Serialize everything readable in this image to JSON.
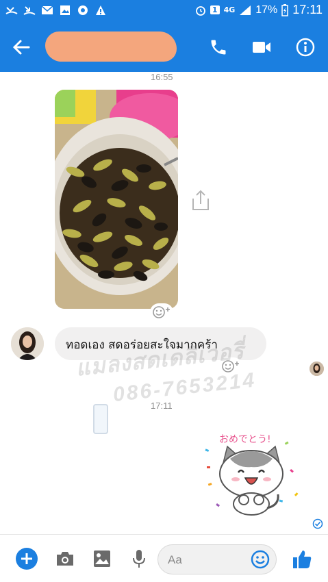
{
  "status_bar": {
    "battery_percent": "17%",
    "time": "17:11",
    "network": "4G",
    "sim_slot": "1"
  },
  "header": {
    "back_icon": "arrow-left-icon",
    "call_icon": "phone-icon",
    "video_icon": "video-camera-icon",
    "info_icon": "info-icon"
  },
  "chat": {
    "timestamp_1": "16:55",
    "message_text": "ทอดเอง สดอร่อยสะใจมากคร้า",
    "timestamp_2": "17:11",
    "watermark_line1": "แมลงสดเดลิเวอรี่",
    "watermark_line2": "086-7653214",
    "sticker_text": "おめでとう!"
  },
  "composer": {
    "placeholder": "Aa"
  },
  "colors": {
    "brand": "#1b7fe0",
    "bubble": "#f1f0f0"
  }
}
